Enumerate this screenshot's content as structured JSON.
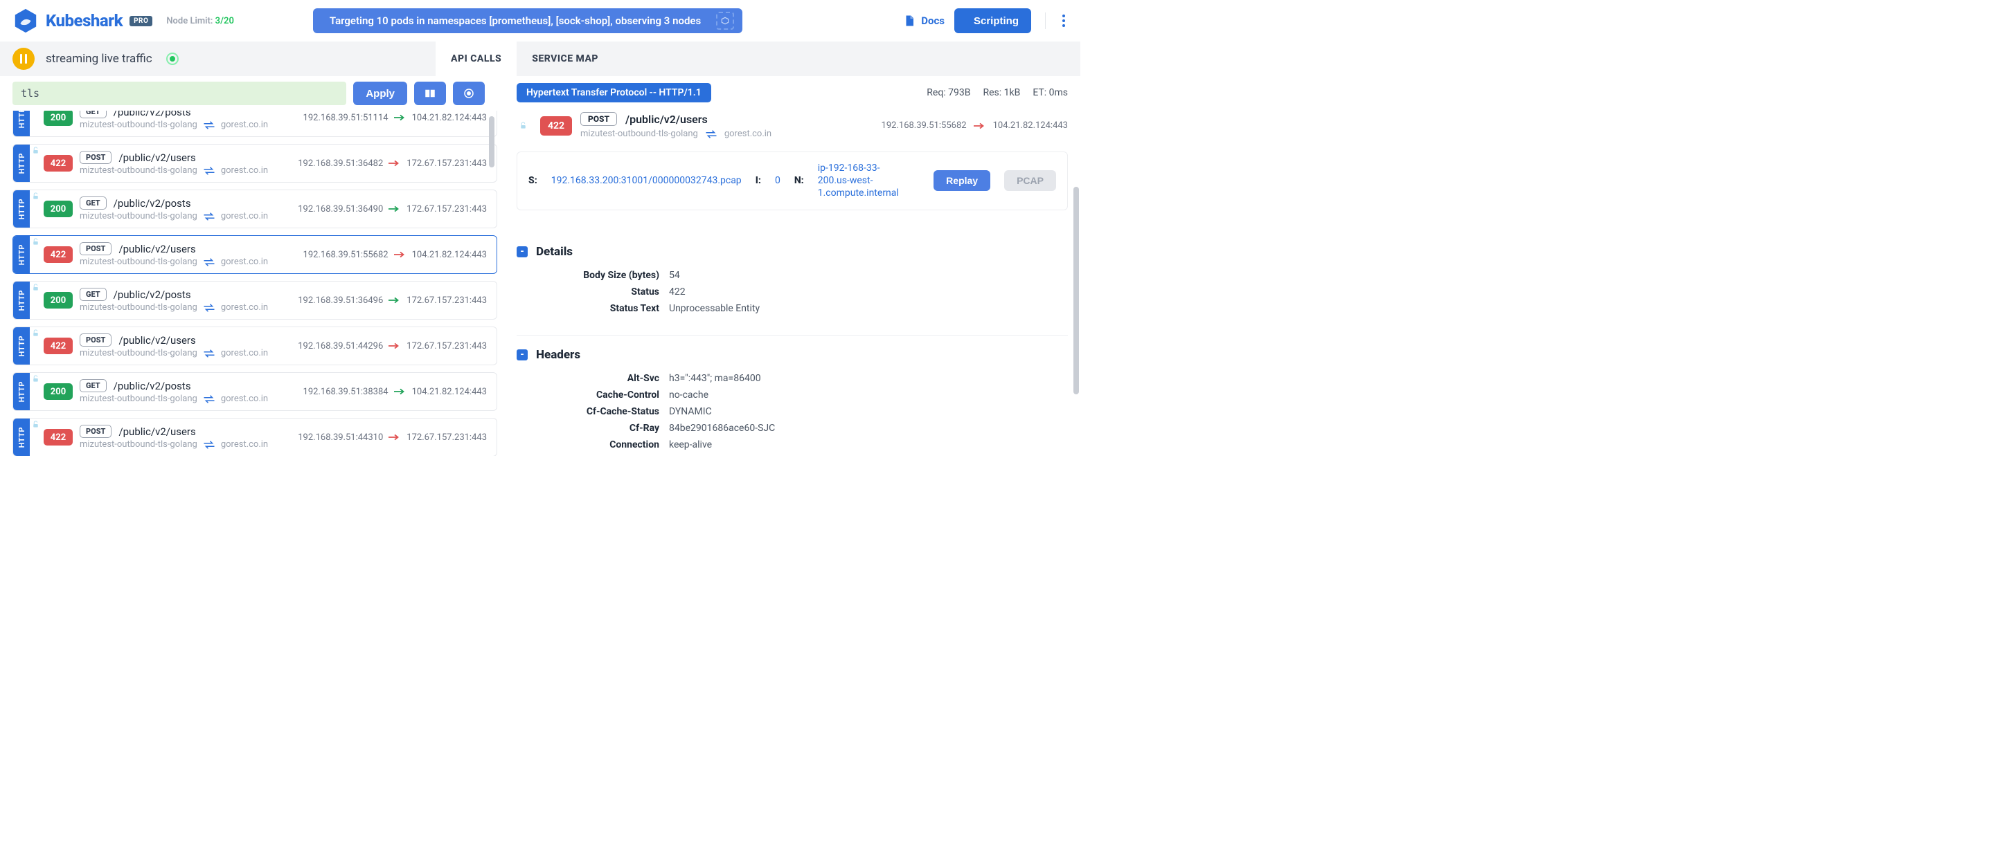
{
  "brand": "Kubeshark",
  "pro_badge": "PRO",
  "node_limit_label": "Node Limit: ",
  "node_limit_count": "3/20",
  "banner": "Targeting 10 pods in namespaces [prometheus], [sock-shop], observing 3 nodes",
  "top_links": {
    "docs": "Docs",
    "scripting": "Scripting"
  },
  "status_text": "streaming live traffic",
  "tabs": {
    "api_calls": "API CALLS",
    "service_map": "SERVICE MAP"
  },
  "query_value": "tls",
  "apply_label": "Apply",
  "streams": [
    {
      "proto": "HTTP",
      "code": "200",
      "code_color": "green",
      "method": "GET",
      "path": "/public/v2/posts",
      "src_label": "mizutest-outbound-tls-golang",
      "dst_label": "gorest.co.in",
      "src_ip": "192.168.39.51:51114",
      "dst_ip": "104.21.82.124:443",
      "arrow": "green",
      "selected": false
    },
    {
      "proto": "HTTP",
      "code": "422",
      "code_color": "red",
      "method": "POST",
      "path": "/public/v2/users",
      "src_label": "mizutest-outbound-tls-golang",
      "dst_label": "gorest.co.in",
      "src_ip": "192.168.39.51:36482",
      "dst_ip": "172.67.157.231:443",
      "arrow": "red",
      "selected": false
    },
    {
      "proto": "HTTP",
      "code": "200",
      "code_color": "green",
      "method": "GET",
      "path": "/public/v2/posts",
      "src_label": "mizutest-outbound-tls-golang",
      "dst_label": "gorest.co.in",
      "src_ip": "192.168.39.51:36490",
      "dst_ip": "172.67.157.231:443",
      "arrow": "green",
      "selected": false
    },
    {
      "proto": "HTTP",
      "code": "422",
      "code_color": "red",
      "method": "POST",
      "path": "/public/v2/users",
      "src_label": "mizutest-outbound-tls-golang",
      "dst_label": "gorest.co.in",
      "src_ip": "192.168.39.51:55682",
      "dst_ip": "104.21.82.124:443",
      "arrow": "red",
      "selected": true
    },
    {
      "proto": "HTTP",
      "code": "200",
      "code_color": "green",
      "method": "GET",
      "path": "/public/v2/posts",
      "src_label": "mizutest-outbound-tls-golang",
      "dst_label": "gorest.co.in",
      "src_ip": "192.168.39.51:36496",
      "dst_ip": "172.67.157.231:443",
      "arrow": "green",
      "selected": false
    },
    {
      "proto": "HTTP",
      "code": "422",
      "code_color": "red",
      "method": "POST",
      "path": "/public/v2/users",
      "src_label": "mizutest-outbound-tls-golang",
      "dst_label": "gorest.co.in",
      "src_ip": "192.168.39.51:44296",
      "dst_ip": "172.67.157.231:443",
      "arrow": "red",
      "selected": false
    },
    {
      "proto": "HTTP",
      "code": "200",
      "code_color": "green",
      "method": "GET",
      "path": "/public/v2/posts",
      "src_label": "mizutest-outbound-tls-golang",
      "dst_label": "gorest.co.in",
      "src_ip": "192.168.39.51:38384",
      "dst_ip": "104.21.82.124:443",
      "arrow": "green",
      "selected": false
    },
    {
      "proto": "HTTP",
      "code": "422",
      "code_color": "red",
      "method": "POST",
      "path": "/public/v2/users",
      "src_label": "mizutest-outbound-tls-golang",
      "dst_label": "gorest.co.in",
      "src_ip": "192.168.39.51:44310",
      "dst_ip": "172.67.157.231:443",
      "arrow": "red",
      "selected": false
    }
  ],
  "detail": {
    "protocol_label": "Hypertext Transfer Protocol -- HTTP/1.1",
    "req_size": "Req: 793B",
    "res_size": "Res: 1kB",
    "elapsed": "ET: 0ms",
    "code": "422",
    "method": "POST",
    "path": "/public/v2/users",
    "src_label": "mizutest-outbound-tls-golang",
    "dst_label": "gorest.co.in",
    "src_ip": "192.168.39.51:55682",
    "dst_ip": "104.21.82.124:443",
    "meta": {
      "s_label": "S:",
      "s_value": "192.168.33.200:31001/000000032743.pcap",
      "i_label": "I:",
      "i_value": "0",
      "n_label": "N:",
      "n_value": "ip-192-168-33-200.us-west-1.compute.internal",
      "replay": "Replay",
      "pcap": "PCAP"
    },
    "sections": {
      "details": {
        "title": "Details",
        "rows": [
          {
            "k": "Body Size (bytes)",
            "v": "54"
          },
          {
            "k": "Status",
            "v": "422"
          },
          {
            "k": "Status Text",
            "v": "Unprocessable Entity"
          }
        ]
      },
      "headers": {
        "title": "Headers",
        "rows": [
          {
            "k": "Alt-Svc",
            "v": "h3=\":443\"; ma=86400"
          },
          {
            "k": "Cache-Control",
            "v": "no-cache"
          },
          {
            "k": "Cf-Cache-Status",
            "v": "DYNAMIC"
          },
          {
            "k": "Cf-Ray",
            "v": "84be2901686ace60-SJC"
          },
          {
            "k": "Connection",
            "v": "keep-alive"
          }
        ]
      }
    }
  }
}
